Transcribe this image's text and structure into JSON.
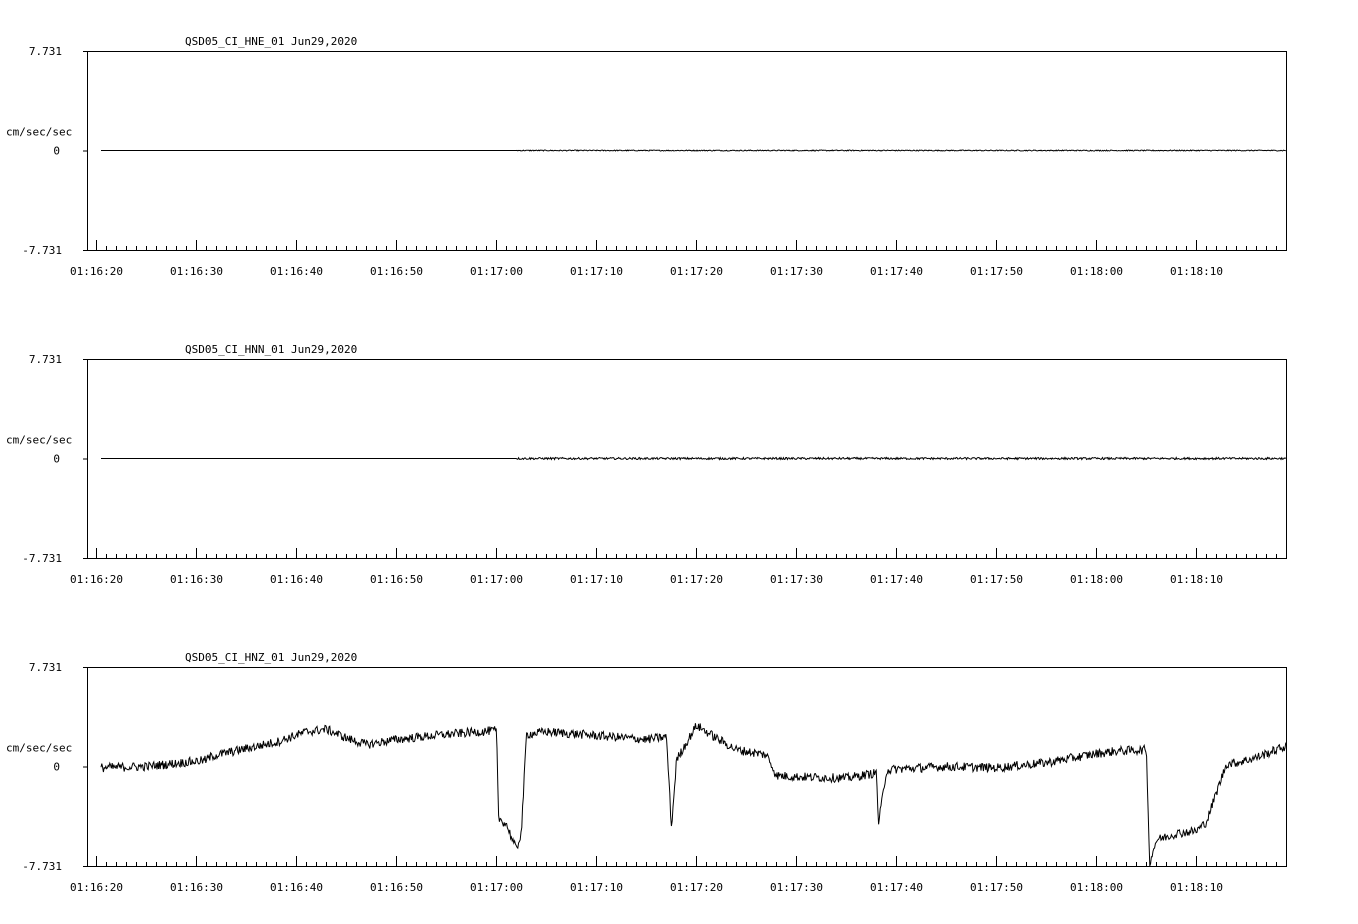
{
  "chart_data": [
    {
      "type": "line",
      "title": "QSD05_CI_HNE_01  Jun29,2020",
      "ylabel": "cm/sec/sec",
      "ylim": [
        -7.731,
        7.731
      ],
      "yticks": [
        "7.731",
        "0",
        "-7.731"
      ],
      "xticks": [
        "01:16:20",
        "01:16:30",
        "01:16:40",
        "01:16:50",
        "01:17:00",
        "01:17:10",
        "01:17:20",
        "01:17:30",
        "01:17:40",
        "01:17:50",
        "01:18:00",
        "01:18:10"
      ],
      "series": [
        {
          "x": [
            "01:16:20",
            "01:16:30",
            "01:16:40",
            "01:16:50",
            "01:17:00",
            "01:17:02",
            "01:17:10",
            "01:17:20",
            "01:17:30",
            "01:17:40",
            "01:17:50",
            "01:18:00",
            "01:18:10",
            "01:18:19"
          ],
          "values": [
            0,
            0,
            0,
            0,
            0,
            0,
            0,
            0,
            0,
            0,
            0,
            0,
            0,
            0
          ]
        }
      ]
    },
    {
      "type": "line",
      "title": "QSD05_CI_HNN_01  Jun29,2020",
      "ylabel": "cm/sec/sec",
      "ylim": [
        -7.731,
        7.731
      ],
      "yticks": [
        "7.731",
        "0",
        "-7.731"
      ],
      "xticks": [
        "01:16:20",
        "01:16:30",
        "01:16:40",
        "01:16:50",
        "01:17:00",
        "01:17:10",
        "01:17:20",
        "01:17:30",
        "01:17:40",
        "01:17:50",
        "01:18:00",
        "01:18:10"
      ],
      "series": [
        {
          "x": [
            "01:16:20",
            "01:16:30",
            "01:16:40",
            "01:16:50",
            "01:17:00",
            "01:17:02",
            "01:17:10",
            "01:17:20",
            "01:17:30",
            "01:17:40",
            "01:17:50",
            "01:18:00",
            "01:18:10",
            "01:18:19"
          ],
          "values": [
            0,
            0,
            0,
            0,
            0,
            0,
            0,
            0,
            0,
            0,
            0,
            0,
            0,
            0
          ]
        }
      ]
    },
    {
      "type": "line",
      "title": "QSD05_CI_HNZ_01  Jun29,2020",
      "ylabel": "cm/sec/sec",
      "ylim": [
        -7.731,
        7.731
      ],
      "yticks": [
        "7.731",
        "0",
        "-7.731"
      ],
      "xticks": [
        "01:16:20",
        "01:16:30",
        "01:16:40",
        "01:16:50",
        "01:17:00",
        "01:17:10",
        "01:17:20",
        "01:17:30",
        "01:17:40",
        "01:17:50",
        "01:18:00",
        "01:18:10"
      ],
      "series": [
        {
          "x": [
            "01:16:20",
            "01:16:25",
            "01:16:31",
            "01:16:31.5",
            "01:16:35",
            "01:16:38",
            "01:16:41",
            "01:16:43",
            "01:16:45",
            "01:16:47",
            "01:16:50",
            "01:16:55",
            "01:17:00",
            "01:17:00.2",
            "01:17:01",
            "01:17:02",
            "01:17:02.5",
            "01:17:03",
            "01:17:05",
            "01:17:10",
            "01:17:15",
            "01:17:17",
            "01:17:17.5",
            "01:17:18",
            "01:17:20",
            "01:17:22",
            "01:17:24",
            "01:17:27",
            "01:17:28",
            "01:17:30",
            "01:17:35",
            "01:17:38",
            "01:17:38.2",
            "01:17:39",
            "01:17:40",
            "01:17:45",
            "01:17:50",
            "01:17:55",
            "01:18:00",
            "01:18:02",
            "01:18:05",
            "01:18:05.3",
            "01:18:06",
            "01:18:08",
            "01:18:10",
            "01:18:11",
            "01:18:12",
            "01:18:13",
            "01:18:14",
            "01:18:16",
            "01:18:19"
          ],
          "values": [
            -0.1,
            0.0,
            0.5,
            0.8,
            1.4,
            1.9,
            2.7,
            2.9,
            2.2,
            1.7,
            2.1,
            2.5,
            2.8,
            -4.0,
            -4.5,
            -6.5,
            -5.0,
            2.5,
            2.7,
            2.4,
            2.1,
            2.3,
            -4.8,
            0.5,
            3.2,
            2.2,
            1.3,
            0.9,
            -0.7,
            -0.8,
            -0.9,
            -0.5,
            -4.5,
            -0.3,
            -0.2,
            0.0,
            -0.1,
            0.3,
            1.0,
            1.2,
            1.3,
            -7.5,
            -5.7,
            -5.2,
            -5.0,
            -4.3,
            -2.0,
            0.2,
            0.3,
            0.7,
            1.6
          ]
        }
      ]
    }
  ]
}
